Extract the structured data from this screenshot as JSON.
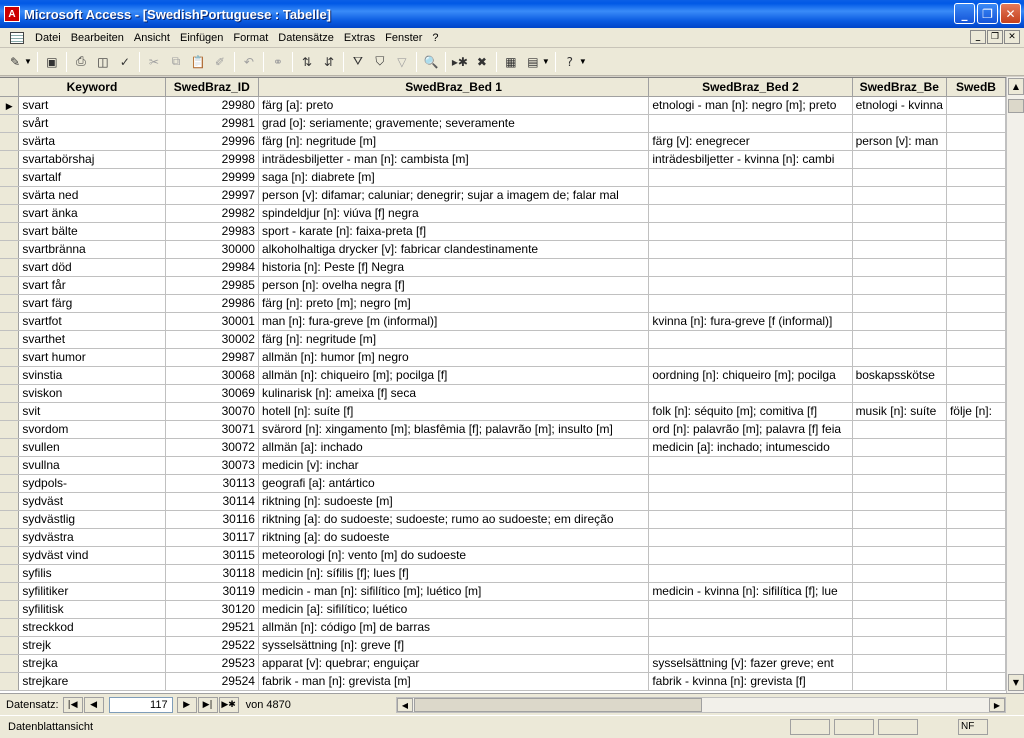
{
  "window": {
    "title": "Microsoft Access - [SwedishPortuguese : Tabelle]"
  },
  "menu": [
    "Datei",
    "Bearbeiten",
    "Ansicht",
    "Einfügen",
    "Format",
    "Datensätze",
    "Extras",
    "Fenster",
    "?"
  ],
  "columns": [
    "Keyword",
    "SwedBraz_ID",
    "SwedBraz_Bed 1",
    "SwedBraz_Bed 2",
    "SwedBraz_Be",
    "SwedB"
  ],
  "rows": [
    [
      "svart",
      "29980",
      "färg [a]: preto",
      "etnologi - man [n]: negro [m]; preto",
      "etnologi - kvinna",
      ""
    ],
    [
      "svårt",
      "29981",
      "grad [o]: seriamente; gravemente; severamente",
      "",
      "",
      ""
    ],
    [
      "svärta",
      "29996",
      "färg [n]: negritude [m]",
      "färg [v]: enegrecer",
      "person [v]: man",
      ""
    ],
    [
      "svartabörshaj",
      "29998",
      "inträdesbiljetter - man [n]: cambista [m]",
      "inträdesbiljetter - kvinna [n]: cambi",
      "",
      ""
    ],
    [
      "svartalf",
      "29999",
      "saga [n]: diabrete [m]",
      "",
      "",
      ""
    ],
    [
      "svärta ned",
      "29997",
      "person [v]: difamar; caluniar; denegrir; sujar a imagem de; falar mal",
      "",
      "",
      ""
    ],
    [
      "svart änka",
      "29982",
      "spindeldjur [n]: viúva [f] negra",
      "",
      "",
      ""
    ],
    [
      "svart bälte",
      "29983",
      "sport - karate [n]: faixa-preta [f]",
      "",
      "",
      ""
    ],
    [
      "svartbränna",
      "30000",
      "alkoholhaltiga drycker [v]: fabricar clandestinamente",
      "",
      "",
      ""
    ],
    [
      "svart död",
      "29984",
      "historia [n]: Peste [f] Negra",
      "",
      "",
      ""
    ],
    [
      "svart får",
      "29985",
      "person [n]: ovelha negra [f]",
      "",
      "",
      ""
    ],
    [
      "svart färg",
      "29986",
      "färg [n]: preto [m]; negro [m]",
      "",
      "",
      ""
    ],
    [
      "svartfot",
      "30001",
      "man [n]: fura-greve [m (informal)]",
      "kvinna [n]: fura-greve [f (informal)]",
      "",
      ""
    ],
    [
      "svarthet",
      "30002",
      "färg [n]: negritude [m]",
      "",
      "",
      ""
    ],
    [
      "svart humor",
      "29987",
      "allmän [n]: humor [m] negro",
      "",
      "",
      ""
    ],
    [
      "svinstia",
      "30068",
      "allmän [n]: chiqueiro [m]; pocilga [f]",
      "oordning [n]: chiqueiro [m]; pocilga",
      "boskapsskötse",
      ""
    ],
    [
      "sviskon",
      "30069",
      "kulinarisk [n]: ameixa [f] seca",
      "",
      "",
      ""
    ],
    [
      "svit",
      "30070",
      "hotell [n]: suíte [f]",
      "folk [n]: séquito [m]; comitiva [f]",
      "musik [n]: suíte",
      "följe [n]:"
    ],
    [
      "svordom",
      "30071",
      "svärord [n]: xingamento [m]; blasfêmia [f]; palavrão [m]; insulto [m]",
      "ord [n]: palavrão [m]; palavra [f] feia",
      "",
      ""
    ],
    [
      "svullen",
      "30072",
      "allmän [a]: inchado",
      "medicin [a]: inchado; intumescido",
      "",
      ""
    ],
    [
      "svullna",
      "30073",
      "medicin [v]: inchar",
      "",
      "",
      ""
    ],
    [
      "sydpols-",
      "30113",
      "geografi [a]: antártico",
      "",
      "",
      ""
    ],
    [
      "sydväst",
      "30114",
      "riktning [n]: sudoeste [m]",
      "",
      "",
      ""
    ],
    [
      "sydvästlig",
      "30116",
      "riktning [a]: do sudoeste; sudoeste; rumo ao sudoeste; em direção",
      "",
      "",
      ""
    ],
    [
      "sydvästra",
      "30117",
      "riktning [a]: do sudoeste",
      "",
      "",
      ""
    ],
    [
      "sydväst vind",
      "30115",
      "meteorologi [n]: vento [m] do sudoeste",
      "",
      "",
      ""
    ],
    [
      "syfilis",
      "30118",
      "medicin [n]: sífilis [f]; lues [f]",
      "",
      "",
      ""
    ],
    [
      "syfilitiker",
      "30119",
      "medicin - man [n]: sifilítico [m]; luético [m]",
      "medicin - kvinna [n]: sifilítica [f]; lue",
      "",
      ""
    ],
    [
      "syfilitisk",
      "30120",
      "medicin [a]: sifilítico; luético",
      "",
      "",
      ""
    ],
    [
      "streckkod",
      "29521",
      "allmän [n]: código [m] de barras",
      "",
      "",
      ""
    ],
    [
      "strejk",
      "29522",
      "sysselsättning [n]: greve [f]",
      "",
      "",
      ""
    ],
    [
      "strejka",
      "29523",
      "apparat [v]: quebrar; enguiçar",
      "sysselsättning [v]: fazer greve; ent",
      "",
      ""
    ],
    [
      "strejkare",
      "29524",
      "fabrik - man [n]: grevista [m]",
      "fabrik - kvinna [n]: grevista [f]",
      "",
      ""
    ]
  ],
  "nav": {
    "label": "Datensatz:",
    "current": "117",
    "of_label": "von 4870"
  },
  "status": {
    "text": "Datenblattansicht",
    "nf": "NF"
  }
}
